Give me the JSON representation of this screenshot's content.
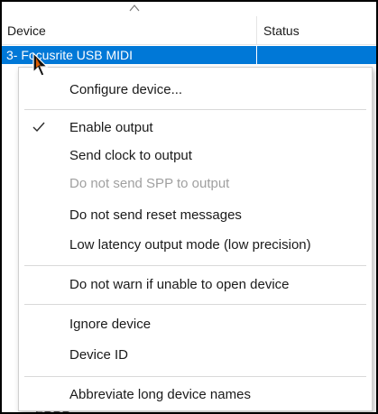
{
  "list": {
    "columns": [
      "Device",
      "Status"
    ],
    "selected_row": {
      "device": "3- Focusrite USB MIDI",
      "status": ""
    },
    "below_text": "ERRR"
  },
  "context_menu": {
    "items": [
      {
        "label": "Configure device...",
        "checked": false,
        "enabled": true
      },
      {
        "label": "Enable output",
        "checked": true,
        "enabled": true
      },
      {
        "label": "Send clock to output",
        "checked": false,
        "enabled": true
      },
      {
        "label": "Do not send SPP to output",
        "checked": false,
        "enabled": false
      },
      {
        "label": "Do not send reset messages",
        "checked": false,
        "enabled": true
      },
      {
        "label": "Low latency output mode (low precision)",
        "checked": false,
        "enabled": true
      },
      {
        "label": "Do not warn if unable to open device",
        "checked": false,
        "enabled": true
      },
      {
        "label": "Ignore device",
        "checked": false,
        "enabled": true
      },
      {
        "label": "Device ID",
        "checked": false,
        "enabled": true
      },
      {
        "label": "Abbreviate long device names",
        "checked": false,
        "enabled": true
      }
    ]
  },
  "colors": {
    "selection": "#0078d7",
    "disabled_text": "#a0a0a0"
  }
}
